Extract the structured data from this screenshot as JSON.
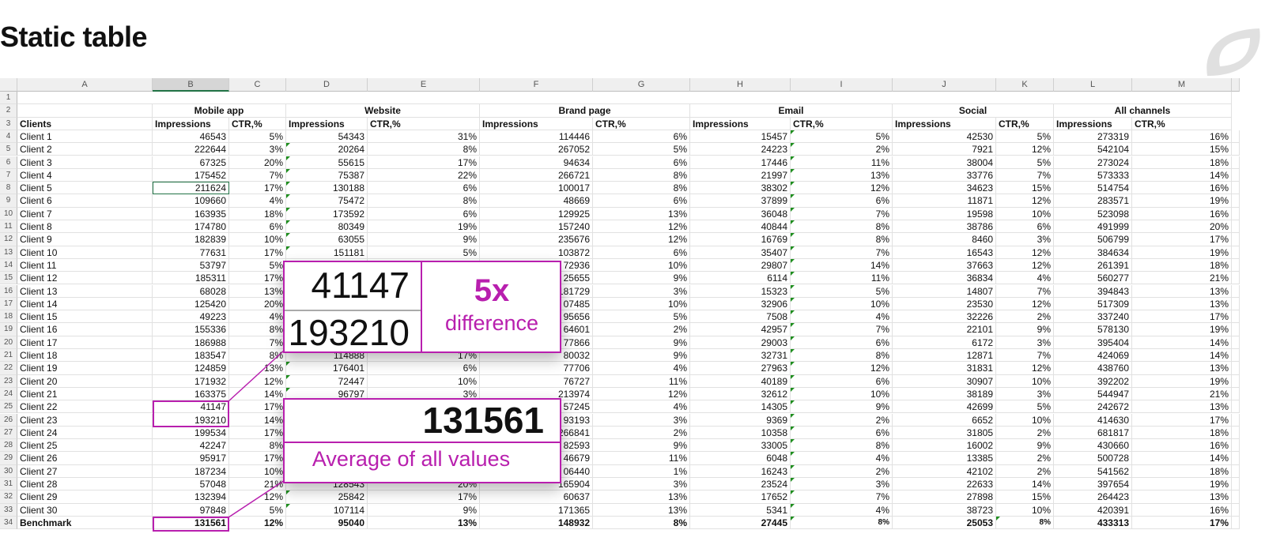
{
  "title": "Static table",
  "accent_color": "#b81fae",
  "columns": [
    "A",
    "B",
    "C",
    "D",
    "E",
    "F",
    "G",
    "H",
    "I",
    "J",
    "K",
    "L",
    "M"
  ],
  "row_numbers": 34,
  "selected_cell": "B8",
  "groups": [
    "Mobile app",
    "Website",
    "Brand page",
    "Email",
    "Social",
    "All channels"
  ],
  "clients_header": "Clients",
  "impressions_label": "Impressions",
  "ctr_label": "CTR,%",
  "rows": [
    [
      "Client 1",
      "46543",
      "5%",
      "54343",
      "31%",
      "114446",
      "6%",
      "15457",
      "5%",
      "42530",
      "5%",
      "273319",
      "16%"
    ],
    [
      "Client 2",
      "222644",
      "3%",
      "20264",
      "8%",
      "267052",
      "5%",
      "24223",
      "2%",
      "7921",
      "12%",
      "542104",
      "15%"
    ],
    [
      "Client 3",
      "67325",
      "20%",
      "55615",
      "17%",
      "94634",
      "6%",
      "17446",
      "11%",
      "38004",
      "5%",
      "273024",
      "18%"
    ],
    [
      "Client 4",
      "175452",
      "7%",
      "75387",
      "22%",
      "266721",
      "8%",
      "21997",
      "13%",
      "33776",
      "7%",
      "573333",
      "14%"
    ],
    [
      "Client 5",
      "211624",
      "17%",
      "130188",
      "6%",
      "100017",
      "8%",
      "38302",
      "12%",
      "34623",
      "15%",
      "514754",
      "16%"
    ],
    [
      "Client 6",
      "109660",
      "4%",
      "75472",
      "8%",
      "48669",
      "6%",
      "37899",
      "6%",
      "11871",
      "12%",
      "283571",
      "19%"
    ],
    [
      "Client 7",
      "163935",
      "18%",
      "173592",
      "6%",
      "129925",
      "13%",
      "36048",
      "7%",
      "19598",
      "10%",
      "523098",
      "16%"
    ],
    [
      "Client 8",
      "174780",
      "6%",
      "80349",
      "19%",
      "157240",
      "12%",
      "40844",
      "8%",
      "38786",
      "6%",
      "491999",
      "20%"
    ],
    [
      "Client 9",
      "182839",
      "10%",
      "63055",
      "9%",
      "235676",
      "12%",
      "16769",
      "8%",
      "8460",
      "3%",
      "506799",
      "17%"
    ],
    [
      "Client 10",
      "77631",
      "17%",
      "151181",
      "5%",
      "103872",
      "6%",
      "35407",
      "7%",
      "16543",
      "12%",
      "384634",
      "19%"
    ],
    [
      "Client 11",
      "53797",
      "5%",
      "",
      "",
      "72936",
      "10%",
      "29807",
      "14%",
      "37663",
      "12%",
      "261391",
      "18%"
    ],
    [
      "Client 12",
      "185311",
      "17%",
      "",
      "",
      "25655",
      "9%",
      "6114",
      "11%",
      "36834",
      "4%",
      "560277",
      "21%"
    ],
    [
      "Client 13",
      "68028",
      "13%",
      "",
      "",
      "181729",
      "3%",
      "15323",
      "5%",
      "14807",
      "7%",
      "394843",
      "13%"
    ],
    [
      "Client 14",
      "125420",
      "20%",
      "",
      "",
      "07485",
      "10%",
      "32906",
      "10%",
      "23530",
      "12%",
      "517309",
      "13%"
    ],
    [
      "Client 15",
      "49223",
      "4%",
      "",
      "",
      "95656",
      "5%",
      "7508",
      "4%",
      "32226",
      "2%",
      "337240",
      "17%"
    ],
    [
      "Client 16",
      "155336",
      "8%",
      "",
      "",
      "64601",
      "2%",
      "42957",
      "7%",
      "22101",
      "9%",
      "578130",
      "19%"
    ],
    [
      "Client 17",
      "186988",
      "7%",
      "",
      "",
      "77866",
      "9%",
      "29003",
      "6%",
      "6172",
      "3%",
      "395404",
      "14%"
    ],
    [
      "Client 18",
      "183547",
      "8%",
      "114888",
      "17%",
      "80032",
      "9%",
      "32731",
      "8%",
      "12871",
      "7%",
      "424069",
      "14%"
    ],
    [
      "Client 19",
      "124859",
      "13%",
      "176401",
      "6%",
      "77706",
      "4%",
      "27963",
      "12%",
      "31831",
      "12%",
      "438760",
      "13%"
    ],
    [
      "Client 20",
      "171932",
      "12%",
      "72447",
      "10%",
      "76727",
      "11%",
      "40189",
      "6%",
      "30907",
      "10%",
      "392202",
      "19%"
    ],
    [
      "Client 21",
      "163375",
      "14%",
      "96797",
      "3%",
      "213974",
      "12%",
      "32612",
      "10%",
      "38189",
      "3%",
      "544947",
      "21%"
    ],
    [
      "Client 22",
      "41147",
      "17%",
      "",
      "",
      "57245",
      "4%",
      "14305",
      "9%",
      "42699",
      "5%",
      "242672",
      "13%"
    ],
    [
      "Client 23",
      "193210",
      "14%",
      "",
      "",
      "93193",
      "3%",
      "9369",
      "2%",
      "6652",
      "10%",
      "414630",
      "17%"
    ],
    [
      "Client 24",
      "199534",
      "17%",
      "",
      "",
      "266841",
      "2%",
      "10358",
      "6%",
      "31805",
      "2%",
      "681817",
      "18%"
    ],
    [
      "Client 25",
      "42247",
      "8%",
      "",
      "",
      "82593",
      "9%",
      "33005",
      "8%",
      "16002",
      "9%",
      "430660",
      "16%"
    ],
    [
      "Client 26",
      "95917",
      "17%",
      "",
      "",
      "46679",
      "11%",
      "6048",
      "4%",
      "13385",
      "2%",
      "500728",
      "14%"
    ],
    [
      "Client 27",
      "187234",
      "10%",
      "",
      "",
      "06440",
      "1%",
      "16243",
      "2%",
      "42102",
      "2%",
      "541562",
      "18%"
    ],
    [
      "Client 28",
      "57048",
      "21%",
      "128543",
      "20%",
      "165904",
      "3%",
      "23524",
      "3%",
      "22633",
      "14%",
      "397654",
      "19%"
    ],
    [
      "Client 29",
      "132394",
      "12%",
      "25842",
      "17%",
      "60637",
      "13%",
      "17652",
      "7%",
      "27898",
      "15%",
      "264423",
      "13%"
    ],
    [
      "Client 30",
      "97848",
      "5%",
      "107114",
      "9%",
      "171365",
      "13%",
      "5341",
      "4%",
      "38723",
      "10%",
      "420391",
      "16%"
    ]
  ],
  "benchmark": [
    "Benchmark",
    "131561",
    "12%",
    "95040",
    "13%",
    "148932",
    "8%",
    "27445",
    "8%",
    "25053",
    "8%",
    "433313",
    "17%"
  ],
  "callout_difference": {
    "value_low": "41147",
    "value_high": "193210",
    "ratio": "5x",
    "label": "difference"
  },
  "callout_average": {
    "value": "131561",
    "label": "Average of all values"
  }
}
